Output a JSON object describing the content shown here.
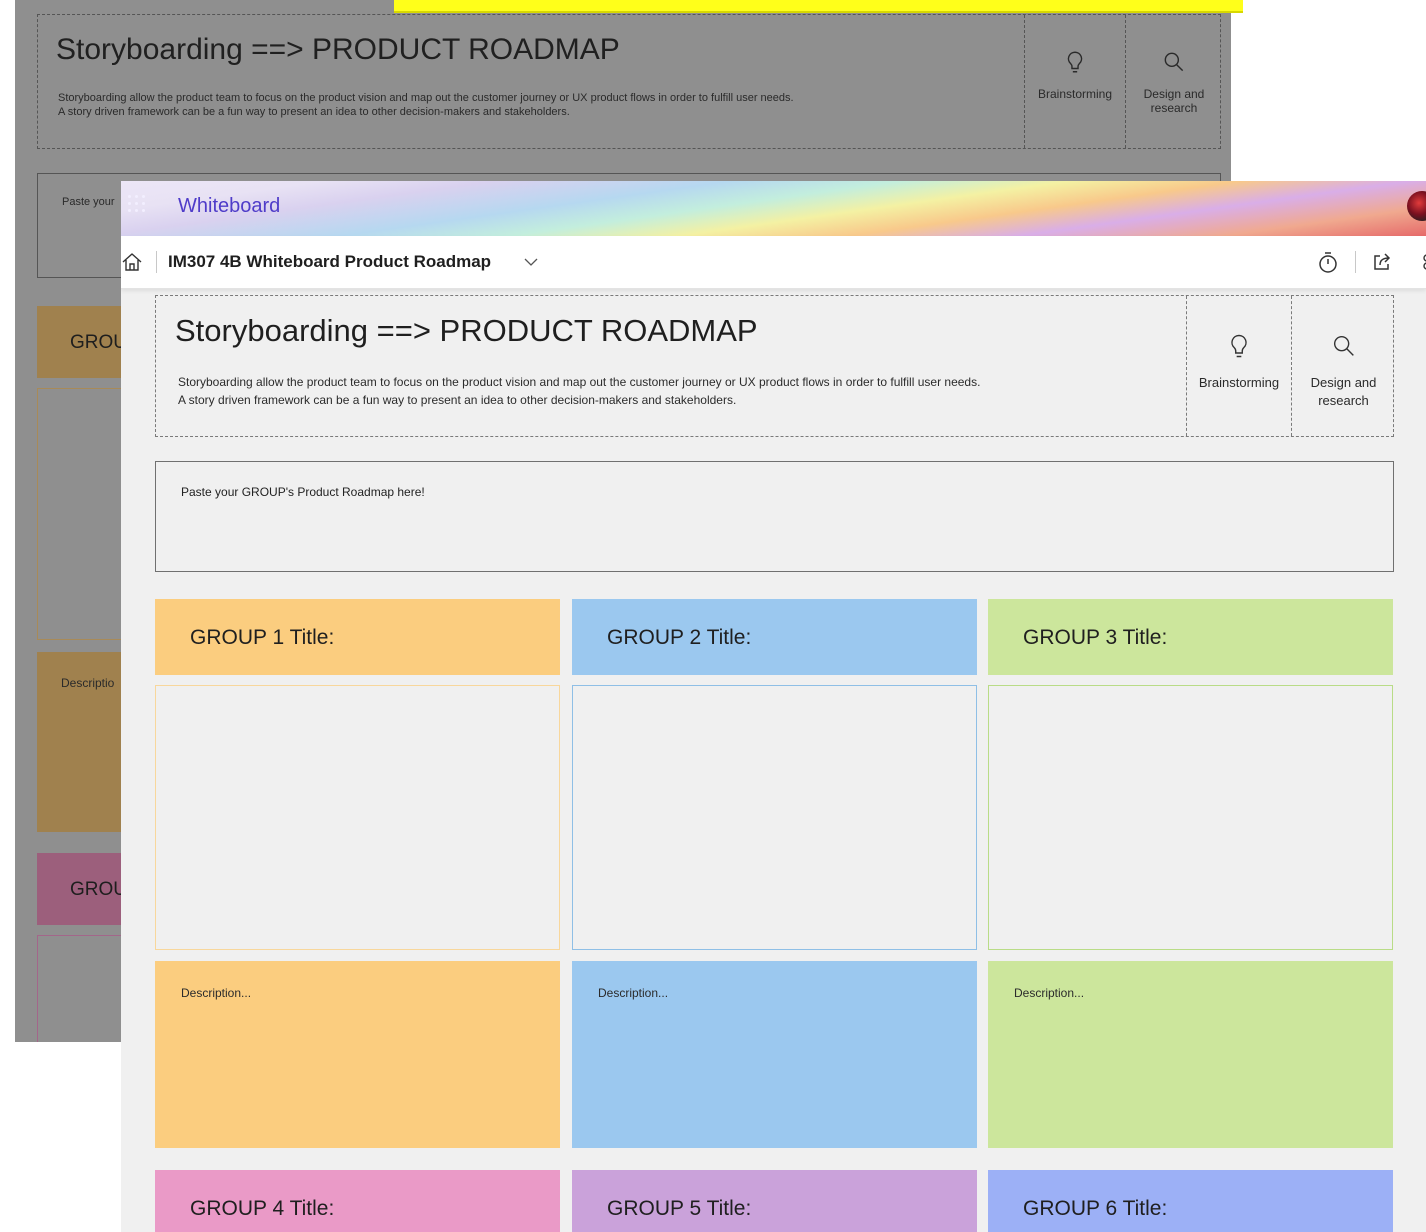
{
  "background_window": {
    "header": {
      "title": "Storyboarding ==> PRODUCT ROADMAP",
      "description_line1": "Storyboarding allow the product team to focus on the product vision and map out the customer journey or UX product flows in order to fulfill user needs.",
      "description_line2": "A story driven framework can be a fun way to present an idea to other decision-makers and stakeholders.",
      "tile_brainstorming": "Brainstorming",
      "tile_design_line1": "Design and",
      "tile_design_line2": "research"
    },
    "paste_text": "Paste your",
    "group_1_title": "GROU",
    "group_4_title": "GROU",
    "description": "Descriptio"
  },
  "app": {
    "name": "Whiteboard",
    "board_title": "IM307 4B Whiteboard Product Roadmap",
    "banner_accent": "#4f3cc9"
  },
  "board": {
    "header": {
      "title": "Storyboarding ==> PRODUCT ROADMAP",
      "description_line1": "Storyboarding allow the product team to focus on the product vision and map out the customer journey or UX product flows in order to fulfill user needs.",
      "description_line2": "A story driven framework can be a fun way to present an idea to other decision-makers and stakeholders.",
      "tile_brainstorming": "Brainstorming",
      "tile_design_line1": "Design and",
      "tile_design_line2": "research"
    },
    "paste_text": "Paste your GROUP's Product Roadmap here!",
    "groups": [
      {
        "title": "GROUP 1 Title:",
        "description": "Description...",
        "color": "#fbcd7f",
        "border": "#f8d79c"
      },
      {
        "title": "GROUP 2 Title:",
        "description": "Description...",
        "color": "#9bc8ef",
        "border": "#8fbfe6"
      },
      {
        "title": "GROUP 3 Title:",
        "description": "Description...",
        "color": "#cce69c",
        "border": "#b9dc87"
      },
      {
        "title": "GROUP 4 Title:",
        "color": "#ea9ac7"
      },
      {
        "title": "GROUP 5 Title:",
        "color": "#caa2da"
      },
      {
        "title": "GROUP 6 Title:",
        "color": "#9cb0f6"
      }
    ]
  }
}
